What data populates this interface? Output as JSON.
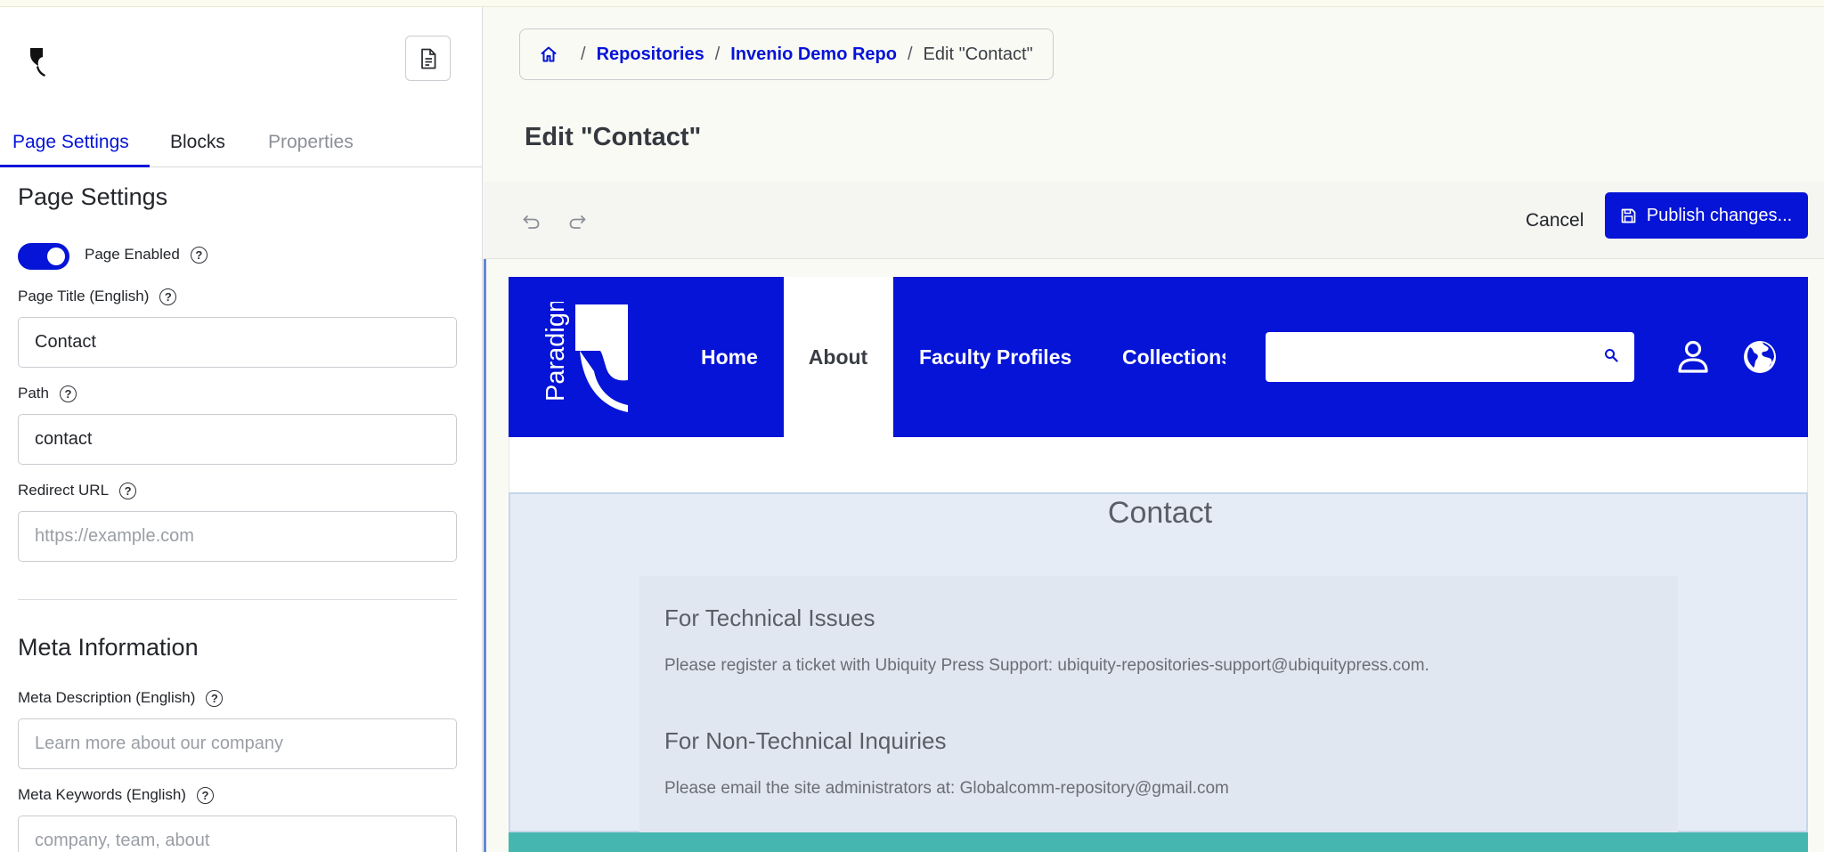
{
  "sidebar": {
    "tabs": [
      {
        "label": "Page Settings",
        "state": "active"
      },
      {
        "label": "Blocks",
        "state": "normal"
      },
      {
        "label": "Properties",
        "state": "disabled"
      }
    ],
    "page_settings": {
      "heading": "Page Settings",
      "enabled_label": "Page Enabled",
      "enabled": true,
      "title_label": "Page Title (English)",
      "title_value": "Contact",
      "path_label": "Path",
      "path_value": "contact",
      "redirect_label": "Redirect URL",
      "redirect_placeholder": "https://example.com"
    },
    "meta": {
      "heading": "Meta Information",
      "description_label": "Meta Description (English)",
      "description_placeholder": "Learn more about our company",
      "keywords_label": "Meta Keywords (English)",
      "keywords_placeholder": "company, team, about"
    }
  },
  "breadcrumb": {
    "home_icon": "home-icon",
    "items": [
      "Repositories",
      "Invenio Demo Repo"
    ],
    "separator": "/",
    "current": "Edit \"Contact\""
  },
  "page_title": "Edit \"Contact\"",
  "toolbar": {
    "undo_icon": "undo-icon",
    "redo_icon": "redo-icon",
    "cancel_label": "Cancel",
    "publish_label": "Publish changes..."
  },
  "preview": {
    "logo_text": "Paradigm",
    "nav": [
      {
        "label": "Home",
        "active": false
      },
      {
        "label": "About",
        "active": true
      },
      {
        "label": "Faculty Profiles",
        "active": false
      },
      {
        "label": "Collections",
        "active": false
      }
    ],
    "search_placeholder": "",
    "contact_heading": "Contact",
    "technical_heading": "For Technical Issues",
    "technical_text": "Please register a ticket with Ubiquity Press Support: ubiquity-repositories-support@ubiquitypress.com.",
    "nontechnical_heading": "For Non-Technical Inquiries",
    "nontechnical_text": "Please email the site administrators at: Globalcomm-repository@gmail.com"
  },
  "colors": {
    "accent": "#0514d6",
    "section_bg": "#e6ecf5",
    "footer_strip": "#46b7b0"
  }
}
